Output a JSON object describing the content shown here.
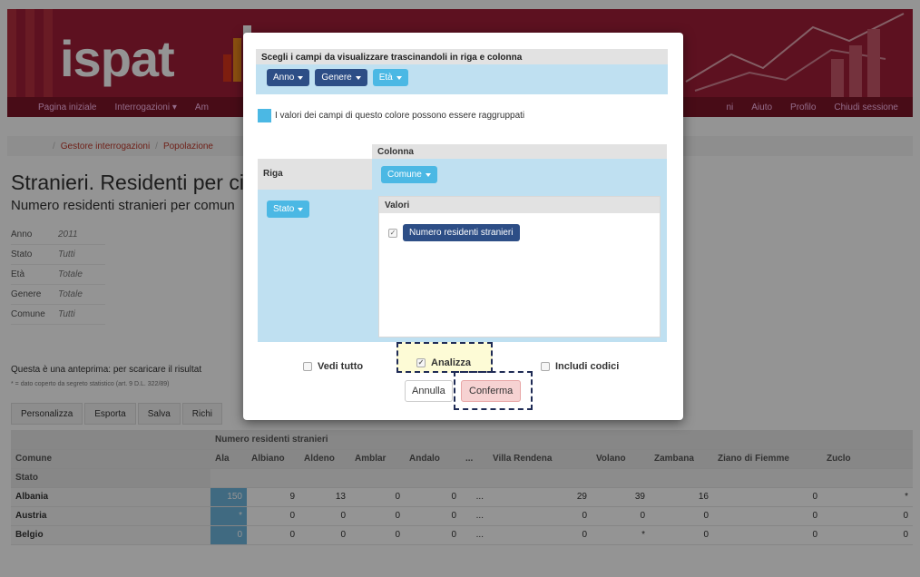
{
  "brand": {
    "logo_text": "ispat"
  },
  "nav": {
    "items_left": [
      "Pagina iniziale",
      "Interrogazioni",
      "Am"
    ],
    "items_right": [
      "ni",
      "Aiuto",
      "Profilo",
      "Chiudi sessione"
    ]
  },
  "breadcrumb": [
    "Gestore interrogazioni",
    "Popolazione"
  ],
  "page": {
    "title": "Stranieri. Residenti per citta",
    "subtitle": "Numero residenti stranieri per comun"
  },
  "filters": [
    {
      "key": "Anno",
      "value": "2011"
    },
    {
      "key": "Stato",
      "value": "Tutti"
    },
    {
      "key": "Età",
      "value": "Totale"
    },
    {
      "key": "Genere",
      "value": "Totale"
    },
    {
      "key": "Comune",
      "value": "Tutti"
    }
  ],
  "notes": {
    "preview": "Questa è una anteprima: per scaricare il risultat",
    "secret": "* = dato coperto da segreto statistico (art. 9 D.L. 322/89)"
  },
  "action_bar": [
    "Personalizza",
    "Esporta",
    "Salva",
    "Richi"
  ],
  "results": {
    "measure_label": "Numero residenti stranieri",
    "row_dim_label": "Comune",
    "row_sub_label": "Stato",
    "columns": [
      "Ala",
      "Albiano",
      "Aldeno",
      "Amblar",
      "Andalo",
      "...",
      "Villa Rendena",
      "Volano",
      "Zambana",
      "Ziano di Fiemme",
      "Zuclo"
    ],
    "rows": [
      {
        "name": "Albania",
        "values": [
          "150",
          "9",
          "13",
          "0",
          "0",
          "...",
          "29",
          "39",
          "16",
          "0",
          "*"
        ]
      },
      {
        "name": "Austria",
        "values": [
          "*",
          "0",
          "0",
          "0",
          "0",
          "...",
          "0",
          "0",
          "0",
          "0",
          "0"
        ]
      },
      {
        "name": "Belgio",
        "values": [
          "0",
          "0",
          "0",
          "0",
          "0",
          "...",
          "0",
          "*",
          "0",
          "0",
          "0"
        ]
      }
    ]
  },
  "modal": {
    "fields_title": "Scegli i campi da visualizzare trascinandoli in riga e colonna",
    "field_anno": "Anno",
    "field_genere": "Genere",
    "field_eta": "Età",
    "legend_text": "I valori dei campi di questo colore possono essere raggruppati",
    "col_label": "Colonna",
    "row_label": "Riga",
    "col_field": "Comune",
    "row_field": "Stato",
    "values_label": "Valori",
    "value_field": "Numero residenti stranieri",
    "opt_vedi_tutto": "Vedi tutto",
    "opt_analizza": "Analizza",
    "opt_includi_codici": "Includi codici",
    "btn_annulla": "Annulla",
    "btn_conferma": "Conferma",
    "colors": {
      "dark_pill": "#2d4e86",
      "light_pill": "#4bb8e4",
      "drop_zone": "#bfe0f1",
      "brand": "#a01e38"
    }
  }
}
